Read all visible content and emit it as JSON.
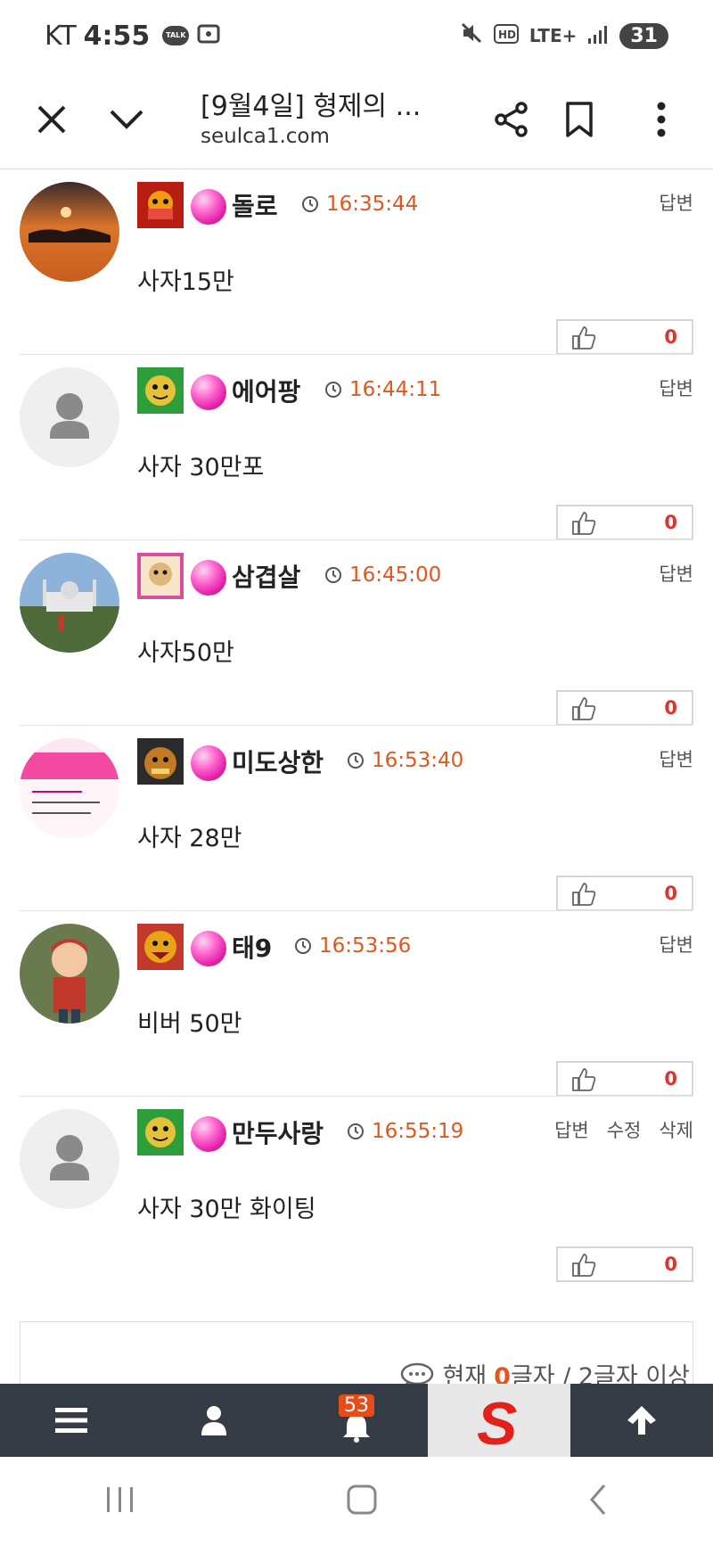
{
  "status": {
    "carrier": "KT",
    "time": "4:55",
    "talk": "TALK",
    "network": "LTE+",
    "battery": "31"
  },
  "browser": {
    "title": "[9월4일] 형제의 ...",
    "url": "seulca1.com"
  },
  "comments": [
    {
      "nick": "돌로",
      "time": "16:35:44",
      "text": "사자15만",
      "reply": "답변",
      "likes": "0"
    },
    {
      "nick": "에어팡",
      "time": "16:44:11",
      "text": "사자 30만포",
      "reply": "답변",
      "likes": "0"
    },
    {
      "nick": "삼겹살",
      "time": "16:45:00",
      "text": "사자50만",
      "reply": "답변",
      "likes": "0"
    },
    {
      "nick": "미도상한",
      "time": "16:53:40",
      "text": "사자 28만",
      "reply": "답변",
      "likes": "0"
    },
    {
      "nick": "태9",
      "time": "16:53:56",
      "text": "비버 50만",
      "reply": "답변",
      "likes": "0"
    },
    {
      "nick": "만두사랑",
      "time": "16:55:19",
      "text": "사자 30만 화이팅",
      "reply": "답변",
      "edit": "수정",
      "delete": "삭제",
      "likes": "0"
    }
  ],
  "composer": {
    "prefix": "현재",
    "count": "0",
    "suffix": "글자 / 2글자 이상"
  },
  "sitenav": {
    "notifications": "53",
    "logo": "S"
  },
  "colors": {
    "accent": "#e0581e",
    "like": "#e4322b",
    "nav_bg": "#353c46",
    "badge": "#e74b1a"
  },
  "icons": {
    "status": [
      "talk-icon",
      "screenshot-icon",
      "mute-icon",
      "hd-icon",
      "signal-icon"
    ],
    "toolbar": [
      "close-icon",
      "chevron-down-icon",
      "share-icon",
      "bookmark-icon",
      "more-icon"
    ],
    "nav": [
      "menu-icon",
      "user-icon",
      "bell-icon",
      "arrow-up-icon"
    ]
  }
}
